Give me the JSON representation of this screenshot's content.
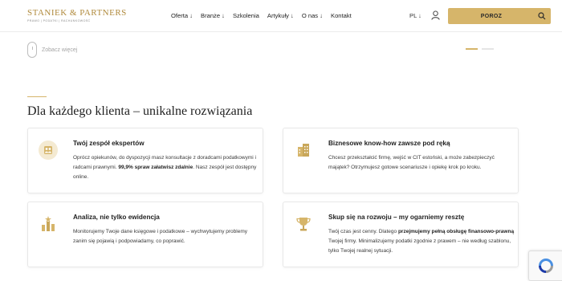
{
  "logo": {
    "name": "STANIEK & PARTNERS",
    "tagline": "PRAWO | PODATKI | RACHUNKOWOŚĆ"
  },
  "nav": {
    "items": [
      "Oferta ↓",
      "Branże ↓",
      "Szkolenia",
      "Artykuły ↓",
      "O nas ↓",
      "Kontakt"
    ]
  },
  "header": {
    "lang": "PL ↓",
    "search_value": "POROZ",
    "user_icon": "user-icon",
    "search_icon": "search-icon"
  },
  "hero": {
    "more_label": "Zobacz więcej"
  },
  "section": {
    "title": "Dla każdego klienta – unikalne rozwiązania"
  },
  "cards": [
    {
      "icon": "team-icon",
      "title": "Twój zespół ekspertów",
      "desc_1": "Oprócz opiekunów, do dyspozycji masz konsultacje z doradcami podatkowymi i radcami prawnymi. ",
      "desc_bold": "99,9% spraw załatwisz zdalnie",
      "desc_2": ". Nasz zespół jest dostępny online."
    },
    {
      "icon": "buildings-icon",
      "title": "Biznesowe know-how zawsze pod ręką",
      "desc_1": "Chcesz przekształcić firmę, wejść w CIT estoński, a może zabezpieczyć majątek? Otrzymujesz gotowe scenariusze i opiekę krok po kroku."
    },
    {
      "icon": "chart-icon",
      "title": "Analiza, nie tylko ewidencja",
      "desc_1": "Monitorujemy Twoje dane księgowe i podatkowe – wychwytujemy problemy zanim się pojawią i podpowiadamy, co poprawić."
    },
    {
      "icon": "trophy-icon",
      "title": "Skup się na rozwoju – my ogarniemy resztę",
      "desc_1": "Twój czas jest cenny. Dlatego ",
      "desc_bold": "przejmujemy pełną obsługę finansowo-prawną",
      "desc_2": " Twojej firmy. Minimalizujemy podatki zgodnie z prawem – nie według szablonu, tylko Twojej realnej sytuacji."
    }
  ],
  "colors": {
    "accent": "#d6b56a",
    "icon_bg": "#f4ead2",
    "logo": "#b08a3c"
  }
}
